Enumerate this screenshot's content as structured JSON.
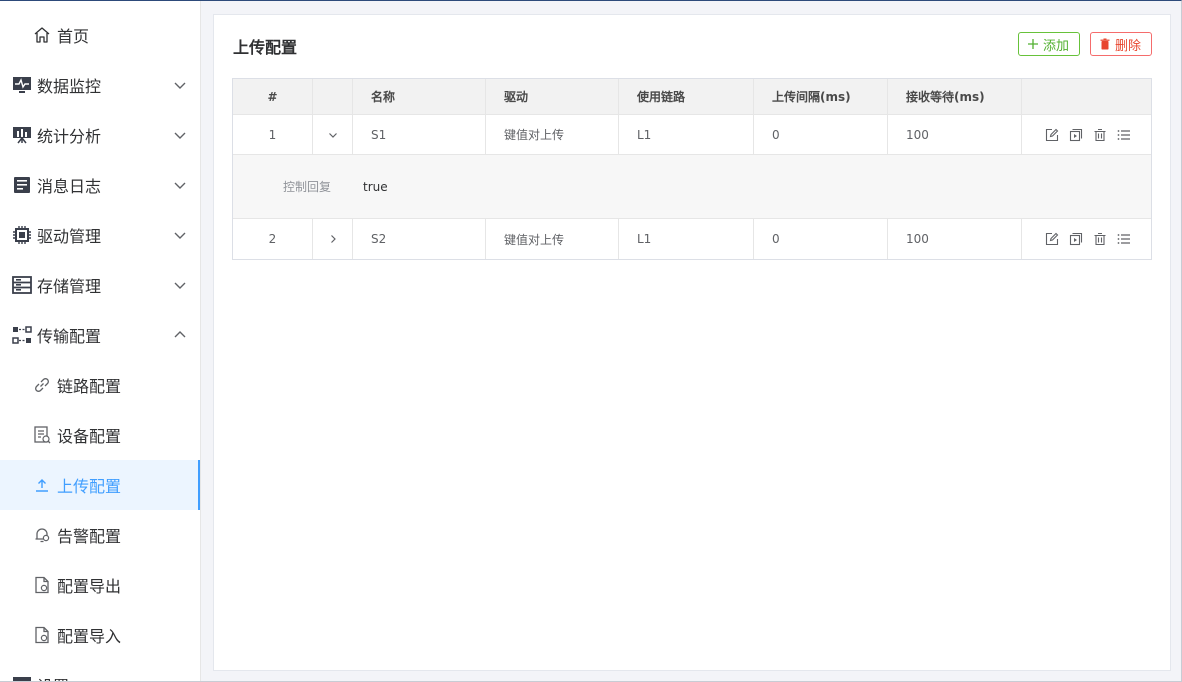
{
  "sidebar": {
    "items": [
      {
        "label": "首页",
        "icon": "home-icon"
      },
      {
        "label": "数据监控",
        "icon": "monitor-icon"
      },
      {
        "label": "统计分析",
        "icon": "presentation-icon"
      },
      {
        "label": "消息日志",
        "icon": "notebook-icon"
      },
      {
        "label": "驱动管理",
        "icon": "chip-icon"
      },
      {
        "label": "存储管理",
        "icon": "storage-icon"
      },
      {
        "label": "传输配置",
        "icon": "transfer-icon"
      },
      {
        "label": "链路配置",
        "icon": "link-icon"
      },
      {
        "label": "设备配置",
        "icon": "device-doc-icon"
      },
      {
        "label": "上传配置",
        "icon": "upload-icon"
      },
      {
        "label": "告警配置",
        "icon": "alarm-icon"
      },
      {
        "label": "配置导出",
        "icon": "export-icon"
      },
      {
        "label": "配置导入",
        "icon": "import-icon"
      },
      {
        "label": "设置",
        "icon": "settings-icon"
      }
    ],
    "active_item": "上传配置",
    "accent_color": "#409eff"
  },
  "main": {
    "title": "上传配置",
    "add_button": "添加",
    "delete_button": "删除",
    "table": {
      "headers": [
        "#",
        "",
        "名称",
        "驱动",
        "使用链路",
        "上传间隔(ms)",
        "接收等待(ms)",
        ""
      ],
      "rows": [
        {
          "index": "1",
          "name": "S1",
          "driver": "键值对上传",
          "link": "L1",
          "interval": "0",
          "wait": "100",
          "expanded": true
        },
        {
          "index": "2",
          "name": "S2",
          "driver": "键值对上传",
          "link": "L1",
          "interval": "0",
          "wait": "100",
          "expanded": false
        }
      ],
      "expand_detail": {
        "label": "控制回复",
        "value": "true"
      }
    }
  }
}
